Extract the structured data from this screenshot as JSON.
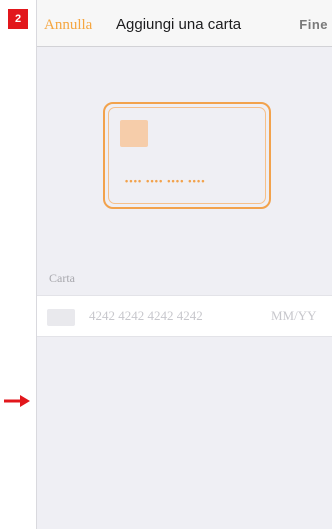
{
  "annotation": {
    "step_number": "2",
    "badge_color": "#e2171c",
    "arrow_color": "#e2171c"
  },
  "nav": {
    "cancel_label": "Annulla",
    "title": "Aggiungi una carta",
    "done_label": "Fine"
  },
  "illustration": {
    "card_number_mask": "•••• •••• •••• ••••",
    "accent_color": "#f2a24c"
  },
  "form": {
    "section_label": "Carta",
    "card_number_placeholder": "4242 4242 4242 4242",
    "expiry_placeholder": "MM/YY",
    "brand_icon": "generic-card-icon"
  },
  "colors": {
    "accent": "#f5a640",
    "background": "#efeff4",
    "placeholder": "#c7c7cc"
  }
}
